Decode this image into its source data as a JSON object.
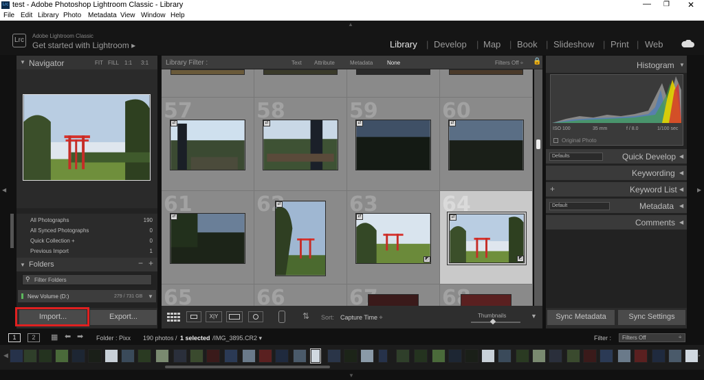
{
  "window": {
    "title": "test - Adobe Photoshop Lightroom Classic - Library",
    "app_badge": "Lrc"
  },
  "menu": [
    "File",
    "Edit",
    "Library",
    "Photo",
    "Metadata",
    "View",
    "Window",
    "Help"
  ],
  "identity": {
    "badge": "Lrc",
    "product": "Adobe Lightroom Classic",
    "tagline": "Get started with Lightroom ▸"
  },
  "modules": [
    "Library",
    "Develop",
    "Map",
    "Book",
    "Slideshow",
    "Print",
    "Web"
  ],
  "navigator": {
    "title": "Navigator",
    "zoom": [
      "FIT",
      "FILL",
      "1:1",
      "3:1"
    ]
  },
  "catalog": [
    {
      "label": "All Photographs",
      "count": "190"
    },
    {
      "label": "All Synced Photographs",
      "count": "0"
    },
    {
      "label": "Quick Collection +",
      "count": "0"
    },
    {
      "label": "Previous Import",
      "count": "1"
    }
  ],
  "folders": {
    "title": "Folders",
    "filter_placeholder": "Filter Folders",
    "volume": "New Volume (D:)",
    "volume_size": "279 / 731 GB"
  },
  "left_buttons": {
    "import": "Import...",
    "export": "Export..."
  },
  "library_filter": {
    "label": "Library Filter :",
    "tabs": [
      "Text",
      "Attribute",
      "Metadata",
      "None"
    ],
    "selected": "None",
    "filters_off": "Filters Off ÷"
  },
  "grid": {
    "row_numbers": [
      "57",
      "58",
      "59",
      "60",
      "61",
      "62",
      "63",
      "64",
      "65",
      "66",
      "67",
      "68"
    ],
    "selected": "64"
  },
  "toolbar": {
    "sort_label": "Sort:",
    "sort_value": "Capture Time ÷",
    "thumbnails_label": "Thumbnails"
  },
  "right_panel": {
    "histogram_title": "Histogram",
    "exif": [
      "ISO 100",
      "35 mm",
      "f / 8.0",
      "1/100 sec"
    ],
    "original_photo": "Original Photo",
    "quick_develop": "Quick Develop",
    "defaults_preset": "Defaults",
    "keywording": "Keywording",
    "keyword_list": "Keyword List",
    "metadata": "Metadata",
    "metadata_preset": "Default",
    "comments": "Comments",
    "sync_metadata": "Sync Metadata",
    "sync_settings": "Sync Settings"
  },
  "filmstrip_bar": {
    "page1": "1",
    "page2": "2",
    "folder": "Folder : Pixx",
    "photo_count": "190 photos /",
    "selected": "1 selected",
    "filename": "/IMG_3895.CR2 ▾",
    "filter_label": "Filter :",
    "filter_value": "Filters Off"
  },
  "colors": {
    "accent_red": "#e02020",
    "panel": "#2b2b2b",
    "grid_bg": "#8a8a8a"
  }
}
